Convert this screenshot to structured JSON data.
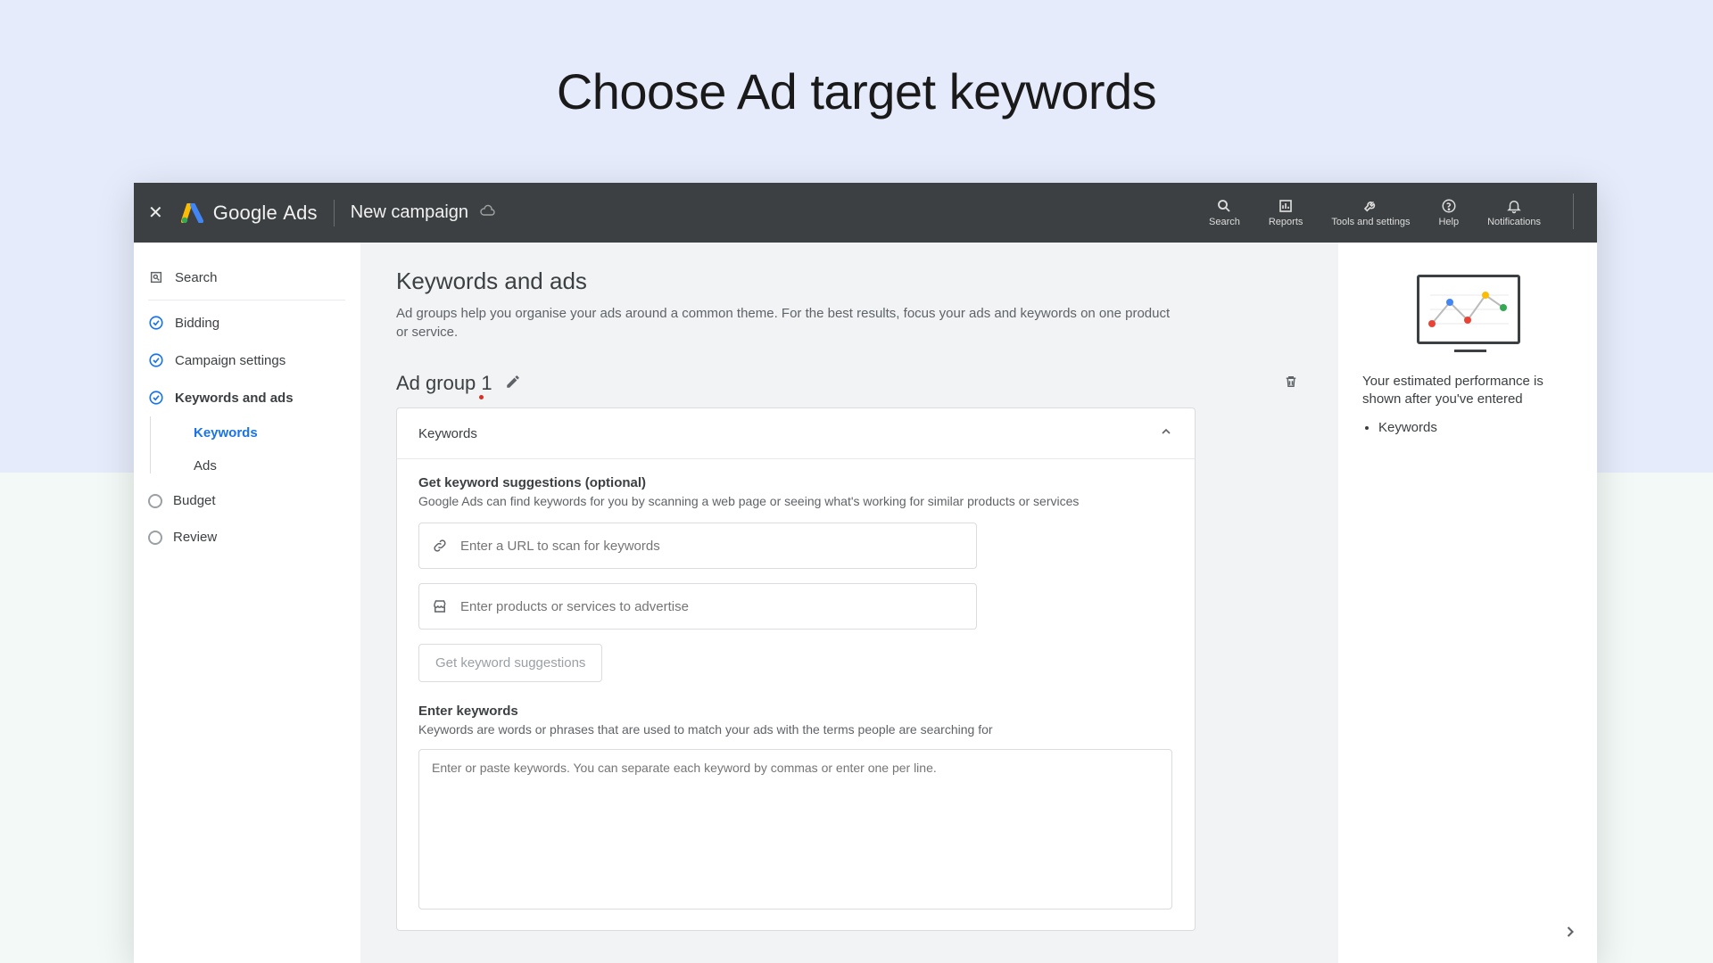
{
  "slide": {
    "title": "Choose Ad target keywords"
  },
  "topbar": {
    "brand_left": "Google",
    "brand_right": "Ads",
    "page": "New campaign",
    "nav": {
      "search": "Search",
      "reports": "Reports",
      "tools": "Tools and settings",
      "help": "Help",
      "notifications": "Notifications"
    }
  },
  "sidebar": {
    "steps": {
      "search": "Search",
      "bidding": "Bidding",
      "campaign": "Campaign settings",
      "keywords_ads": "Keywords and ads",
      "keywords": "Keywords",
      "ads": "Ads",
      "budget": "Budget",
      "review": "Review"
    }
  },
  "main": {
    "title": "Keywords and ads",
    "desc": "Ad groups help you organise your ads around a common theme. For the best results, focus your ads and keywords on one product or service.",
    "group_name": "Ad group 1",
    "card": {
      "header": "Keywords",
      "suggest_title": "Get keyword suggestions (optional)",
      "suggest_desc": "Google Ads can find keywords for you by scanning a web page or seeing what's working for similar products or services",
      "url_placeholder": "Enter a URL to scan for keywords",
      "products_placeholder": "Enter products or services to advertise",
      "suggest_btn": "Get keyword suggestions",
      "enter_title": "Enter keywords",
      "enter_desc": "Keywords are words or phrases that are used to match your ads with the terms people are searching for",
      "textarea_placeholder": "Enter or paste keywords. You can separate each keyword by commas or enter one per line."
    }
  },
  "rightpanel": {
    "text": "Your estimated performance is shown after you've entered",
    "bullet": "Keywords"
  }
}
